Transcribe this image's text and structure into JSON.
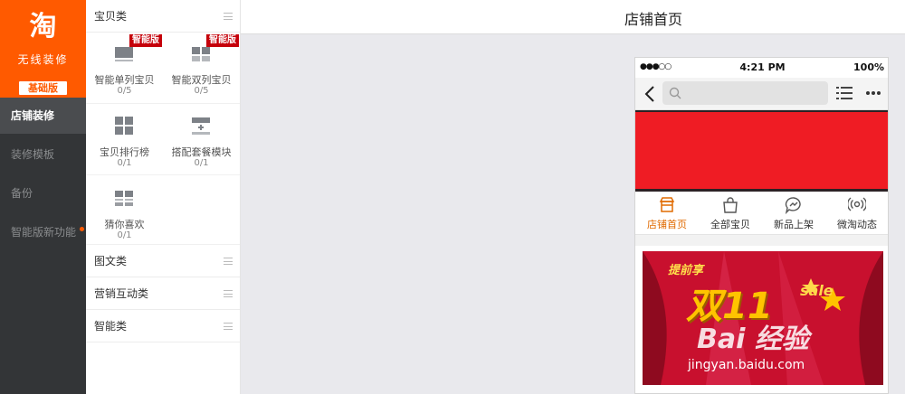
{
  "app": {
    "logo_glyph": "淘",
    "logo_subtitle": "无线装修",
    "plan_badge": "基础版"
  },
  "sidebar": {
    "items": [
      {
        "label": "店铺装修",
        "active": true
      },
      {
        "label": "装修模板",
        "active": false
      },
      {
        "label": "备份",
        "active": false
      },
      {
        "label": "智能版新功能",
        "active": false,
        "notify_dot": true
      }
    ]
  },
  "widget_panel": {
    "categories": [
      {
        "label": "宝贝类",
        "expanded": true
      },
      {
        "label": "图文类",
        "expanded": false
      },
      {
        "label": "营销互动类",
        "expanded": false
      },
      {
        "label": "智能类",
        "expanded": false
      }
    ],
    "widgets": [
      {
        "label": "智能单列宝贝",
        "count": "0/5",
        "badge": "智能版",
        "icon": "single-column-item-icon"
      },
      {
        "label": "智能双列宝贝",
        "count": "0/5",
        "badge": "智能版",
        "icon": "double-column-item-icon"
      },
      {
        "label": "宝贝排行榜",
        "count": "0/1",
        "badge": "",
        "icon": "ranking-grid-icon"
      },
      {
        "label": "搭配套餐模块",
        "count": "0/1",
        "badge": "",
        "icon": "bundle-module-icon"
      },
      {
        "label": "猜你喜欢",
        "count": "0/1",
        "badge": "",
        "icon": "guess-you-like-icon"
      }
    ]
  },
  "header": {
    "page_title": "店铺首页"
  },
  "phone": {
    "status": {
      "signal": "●●●○○",
      "time": "4:21 PM",
      "battery": "100%"
    },
    "shop_nav": [
      {
        "label": "店铺首页",
        "icon": "shop-icon",
        "active": true
      },
      {
        "label": "全部宝贝",
        "icon": "bag-icon",
        "active": false
      },
      {
        "label": "新品上架",
        "icon": "chat-icon",
        "active": false
      },
      {
        "label": "微淘动态",
        "icon": "broadcast-icon",
        "active": false
      }
    ],
    "promo": {
      "kicker": "提前享",
      "main": "双11",
      "sale": "sale",
      "watermark": "Bai 经验",
      "watermark_url": "jingyan.baidu.com"
    }
  },
  "colors": {
    "brand_orange": "#ff5a00",
    "sidebar_dark": "#333537",
    "badge_red": "#c5000a",
    "banner_red": "#ef1c24",
    "active_tab": "#e06a00"
  }
}
